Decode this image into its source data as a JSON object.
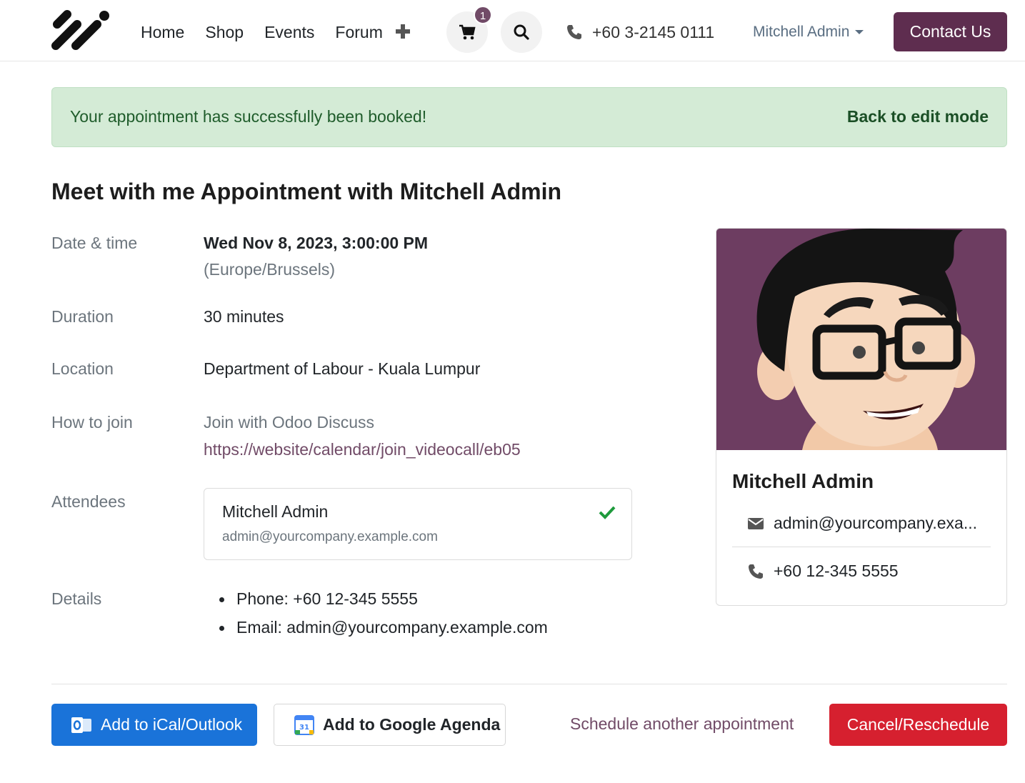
{
  "header": {
    "nav": [
      "Home",
      "Shop",
      "Events",
      "Forum"
    ],
    "cart_count": "1",
    "phone": "+60 3-2145 0111",
    "user": "Mitchell Admin",
    "contact_label": "Contact Us"
  },
  "alert": {
    "message": "Your appointment has successfully been booked!",
    "edit_link": "Back to edit mode"
  },
  "title": "Meet with me Appointment with Mitchell Admin",
  "info": {
    "date_label": "Date & time",
    "date_value": "Wed Nov 8, 2023, 3:00:00 PM",
    "timezone": "(Europe/Brussels)",
    "duration_label": "Duration",
    "duration_value": "30 minutes",
    "location_label": "Location",
    "location_value": "Department of Labour - Kuala Lumpur",
    "join_label": "How to join",
    "join_text": "Join with Odoo Discuss",
    "join_url": "https://website/calendar/join_videocall/eb05",
    "attendees_label": "Attendees",
    "attendee_name": "Mitchell Admin",
    "attendee_email": "admin@yourcompany.example.com",
    "details_label": "Details",
    "details": [
      "Phone: +60 12-345 5555",
      "Email: admin@yourcompany.example.com"
    ]
  },
  "card": {
    "name": "Mitchell Admin",
    "email": "admin@yourcompany.exa...",
    "phone": "+60 12-345 5555"
  },
  "footer": {
    "ical_label": "Add to iCal/Outlook",
    "gcal_label": "Add to Google Agenda",
    "schedule_label": "Schedule another appointment",
    "cancel_label": "Cancel/Reschedule"
  }
}
